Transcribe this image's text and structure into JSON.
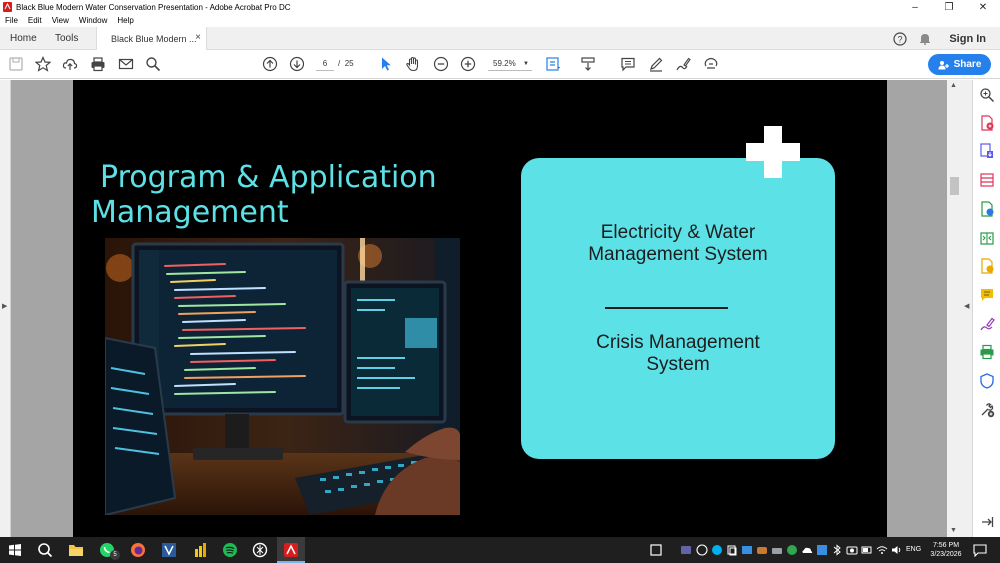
{
  "window": {
    "title": "Black Blue Modern Water Conservation Presentation - Adobe Acrobat Pro DC",
    "controls": [
      "minimize",
      "maximize",
      "close"
    ]
  },
  "menu": [
    "File",
    "Edit",
    "View",
    "Window",
    "Help"
  ],
  "tabs": {
    "home": "Home",
    "tools": "Tools",
    "document": "Black Blue Modern ...",
    "close": "×",
    "signin": "Sign In"
  },
  "toolbar": {
    "page_current": "6",
    "page_separator": "/",
    "page_total": "25",
    "zoom": "59.2%",
    "share": "Share"
  },
  "slide": {
    "title_line1": "Program & Application",
    "title_line2": "Management",
    "card_line1a": "Electricity & Water",
    "card_line1b": "Management System",
    "card_line2a": "Crisis Management",
    "card_line2b": "System",
    "colors": {
      "accent": "#5ce1e6",
      "background": "#000000"
    }
  },
  "right_pane_tools": [
    "search-zoom-icon",
    "export-pdf-icon",
    "create-pdf-icon",
    "organize-pages-icon",
    "edit-pdf-icon",
    "compress-icon",
    "send-for-comments-icon",
    "comment-icon",
    "fill-sign-icon",
    "print-production-icon",
    "protect-icon",
    "more-tools-icon"
  ],
  "taskbar": {
    "whatsapp_badge": "5",
    "lang": "ENG",
    "time": "7:56 PM",
    "date": "3/23/2026"
  }
}
